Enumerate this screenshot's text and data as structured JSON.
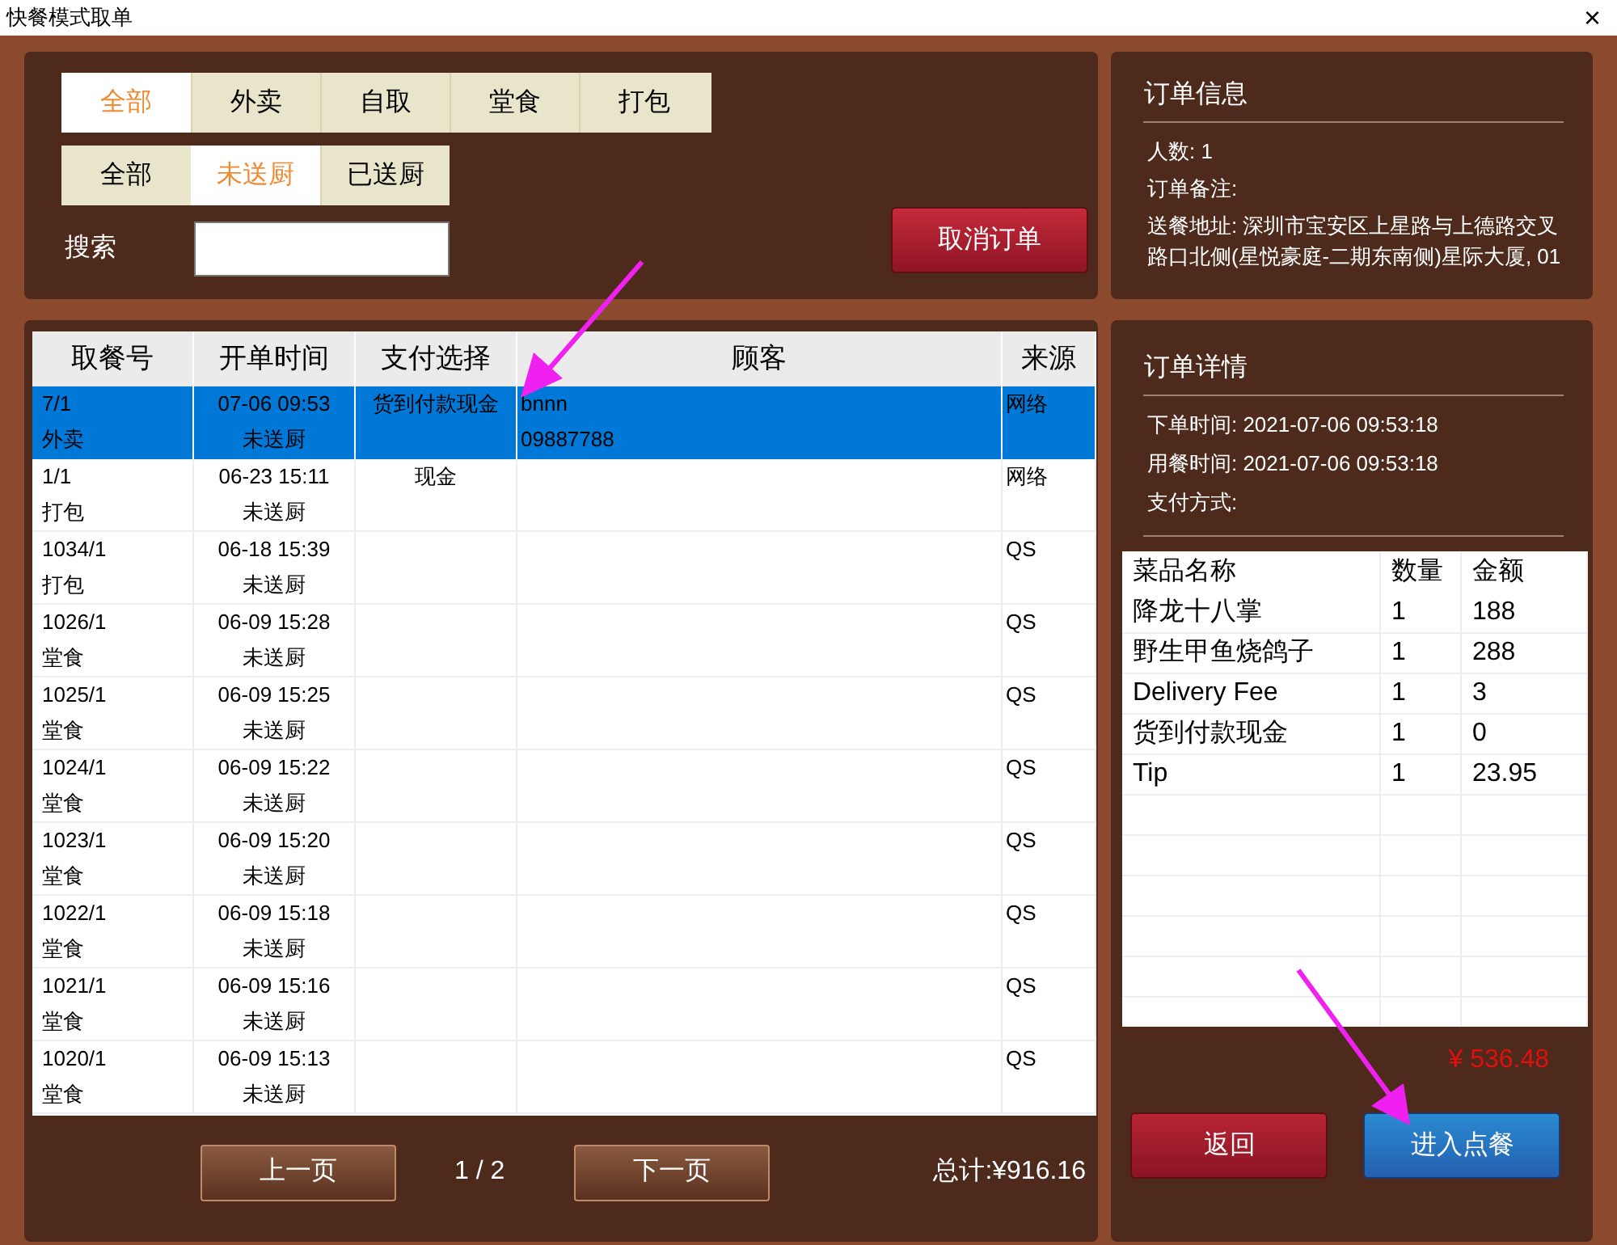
{
  "window": {
    "title": "快餐模式取单",
    "close": "×"
  },
  "order_type_tabs": [
    {
      "label": "全部",
      "selected": true
    },
    {
      "label": "外卖",
      "selected": false
    },
    {
      "label": "自取",
      "selected": false
    },
    {
      "label": "堂食",
      "selected": false
    },
    {
      "label": "打包",
      "selected": false
    }
  ],
  "kitchen_tabs": [
    {
      "label": "全部",
      "selected": false
    },
    {
      "label": "未送厨",
      "selected": true
    },
    {
      "label": "已送厨",
      "selected": false
    }
  ],
  "search": {
    "label": "搜索"
  },
  "cancel_button": "取消订单",
  "orders_table": {
    "columns": [
      "取餐号",
      "开单时间",
      "支付选择",
      "顾客",
      "来源"
    ],
    "rows": [
      {
        "number": "7/1",
        "type": "外卖",
        "time": "07-06 09:53",
        "status": "未送厨",
        "payment": "货到付款现金",
        "customer": [
          "bnnn",
          "09887788"
        ],
        "source": "网络",
        "selected": true
      },
      {
        "number": "1/1",
        "type": "打包",
        "time": "06-23 15:11",
        "status": "未送厨",
        "payment": "现金",
        "source": "网络",
        "selected": false
      },
      {
        "number": "1034/1",
        "type": "打包",
        "time": "06-18 15:39",
        "status": "未送厨",
        "source": "QS",
        "selected": false
      },
      {
        "number": "1026/1",
        "type": "堂食",
        "time": "06-09 15:28",
        "status": "未送厨",
        "source": "QS",
        "selected": false
      },
      {
        "number": "1025/1",
        "type": "堂食",
        "time": "06-09 15:25",
        "status": "未送厨",
        "source": "QS",
        "selected": false
      },
      {
        "number": "1024/1",
        "type": "堂食",
        "time": "06-09 15:22",
        "status": "未送厨",
        "source": "QS",
        "selected": false
      },
      {
        "number": "1023/1",
        "type": "堂食",
        "time": "06-09 15:20",
        "status": "未送厨",
        "source": "QS",
        "selected": false
      },
      {
        "number": "1022/1",
        "type": "堂食",
        "time": "06-09 15:18",
        "status": "未送厨",
        "source": "QS",
        "selected": false
      },
      {
        "number": "1021/1",
        "type": "堂食",
        "time": "06-09 15:16",
        "status": "未送厨",
        "source": "QS",
        "selected": false
      },
      {
        "number": "1020/1",
        "type": "堂食",
        "time": "06-09 15:13",
        "status": "未送厨",
        "source": "QS",
        "selected": false
      }
    ]
  },
  "pagination": {
    "prev": "上一页",
    "page": "1 / 2",
    "next": "下一页",
    "total": "总计:¥916.16"
  },
  "order_info": {
    "title": "订单信息",
    "lines": [
      "人数: 1",
      "订单备注:",
      "送餐地址: 深圳市宝安区上星路与上德路交叉路口北侧(星悦豪庭-二期东南侧)星际大厦, 01"
    ]
  },
  "order_detail": {
    "title": "订单详情",
    "lines": [
      "下单时间: 2021-07-06 09:53:18",
      "用餐时间: 2021-07-06 09:53:18",
      "支付方式:"
    ]
  },
  "items_table": {
    "columns": [
      "菜品名称",
      "数量",
      "金额"
    ],
    "rows": [
      [
        "降龙十八掌",
        "1",
        "188"
      ],
      [
        "野生甲鱼烧鸽子",
        "1",
        "288"
      ],
      [
        "Delivery Fee",
        "1",
        "3"
      ],
      [
        "货到付款现金",
        "1",
        "0"
      ],
      [
        "Tip",
        "1",
        "23.95"
      ]
    ]
  },
  "items_total": "¥ 536.48",
  "back_button": "返回",
  "enter_button": "进入点餐"
}
